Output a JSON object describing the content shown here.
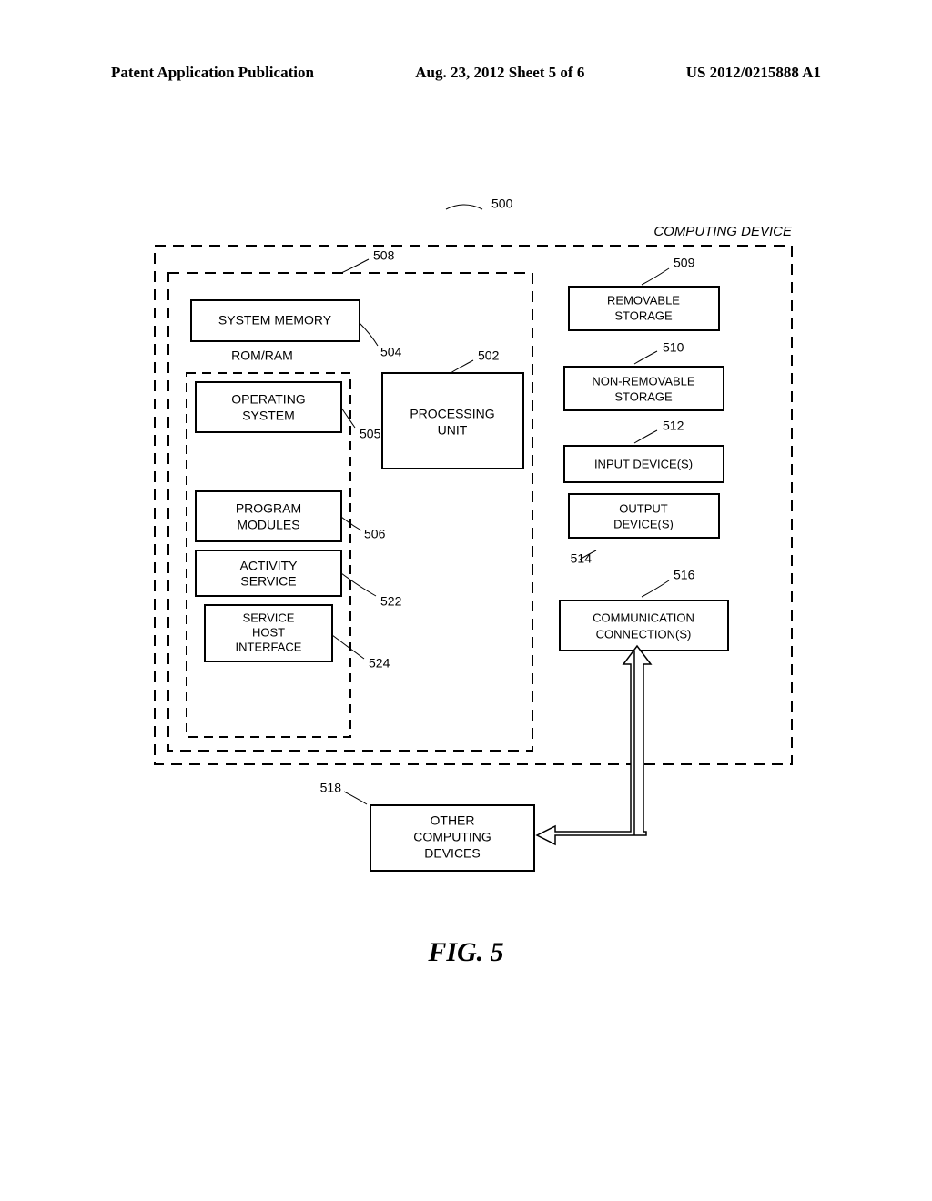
{
  "header": {
    "left": "Patent Application Publication",
    "center": "Aug. 23, 2012  Sheet 5 of 6",
    "right": "US 2012/0215888 A1"
  },
  "figure": {
    "caption": "FIG. 5",
    "device_title": "COMPUTING DEVICE",
    "boxes": {
      "system_memory": "SYSTEM MEMORY",
      "rom_ram": "ROM/RAM",
      "operating_system_l1": "OPERATING",
      "operating_system_l2": "SYSTEM",
      "program_modules_l1": "PROGRAM",
      "program_modules_l2": "MODULES",
      "activity_service_l1": "ACTIVITY",
      "activity_service_l2": "SERVICE",
      "service_host_l1": "SERVICE",
      "service_host_l2": "HOST",
      "service_host_l3": "INTERFACE",
      "processing_unit_l1": "PROCESSING",
      "processing_unit_l2": "UNIT",
      "removable_storage_l1": "REMOVABLE",
      "removable_storage_l2": "STORAGE",
      "non_removable_l1": "NON-REMOVABLE",
      "non_removable_l2": "STORAGE",
      "input_devices": "INPUT DEVICE(S)",
      "output_devices_l1": "OUTPUT",
      "output_devices_l2": "DEVICE(S)",
      "communication_l1": "COMMUNICATION",
      "communication_l2": "CONNECTION(S)",
      "other_l1": "OTHER",
      "other_l2": "COMPUTING",
      "other_l3": "DEVICES"
    },
    "refs": {
      "r500": "500",
      "r502": "502",
      "r504": "504",
      "r505": "505",
      "r506": "506",
      "r508": "508",
      "r509": "509",
      "r510": "510",
      "r512": "512",
      "r514": "514",
      "r516": "516",
      "r518": "518",
      "r522": "522",
      "r524": "524"
    }
  }
}
